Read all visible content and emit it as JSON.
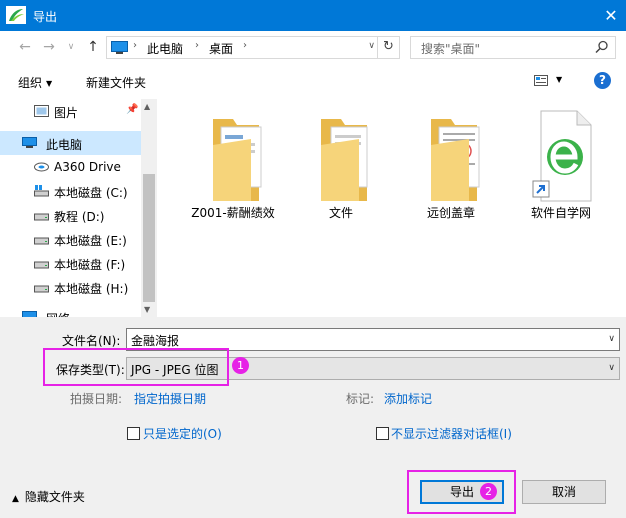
{
  "window": {
    "title": "导出"
  },
  "nav": {
    "path": [
      "此电脑",
      "桌面"
    ],
    "search_placeholder": "搜索\"桌面\""
  },
  "toolbar": {
    "organize": "组织",
    "new_folder": "新建文件夹"
  },
  "sidebar": {
    "items": [
      {
        "label": "图片",
        "icon": "pictures-icon"
      },
      {
        "label": "此电脑",
        "icon": "computer-icon"
      },
      {
        "label": "A360 Drive",
        "icon": "cloud-drive-icon"
      },
      {
        "label": "本地磁盘 (C:)",
        "icon": "drive-icon"
      },
      {
        "label": "教程 (D:)",
        "icon": "drive-icon"
      },
      {
        "label": "本地磁盘 (E:)",
        "icon": "drive-icon"
      },
      {
        "label": "本地磁盘 (F:)",
        "icon": "drive-icon"
      },
      {
        "label": "本地磁盘 (H:)",
        "icon": "drive-icon"
      },
      {
        "label": "网络",
        "icon": "network-icon"
      }
    ]
  },
  "files": [
    {
      "label": "Z001-薪酬绩效",
      "icon": "folder-icon"
    },
    {
      "label": "文件",
      "icon": "folder-icon"
    },
    {
      "label": "远创盖章",
      "icon": "folder-icon"
    },
    {
      "label": "软件自学网",
      "icon": "browser-shortcut-icon"
    }
  ],
  "form": {
    "filename_label": "文件名(N):",
    "filename_value": "金融海报",
    "filetype_label": "保存类型(T):",
    "filetype_value": "JPG - JPEG 位图",
    "date_label": "拍摄日期:",
    "date_link": "指定拍摄日期",
    "tags_label": "标记:",
    "tags_link": "添加标记",
    "only_selected": "只是选定的(O)",
    "no_filter_dialog": "不显示过滤器对话框(I)",
    "hide_folders": "隐藏文件夹"
  },
  "buttons": {
    "export": "导出",
    "cancel": "取消"
  },
  "badges": {
    "one": "1",
    "two": "2"
  },
  "colors": {
    "titlebar": "#0078d7",
    "highlight": "#e622e6",
    "link": "#0066cc"
  }
}
